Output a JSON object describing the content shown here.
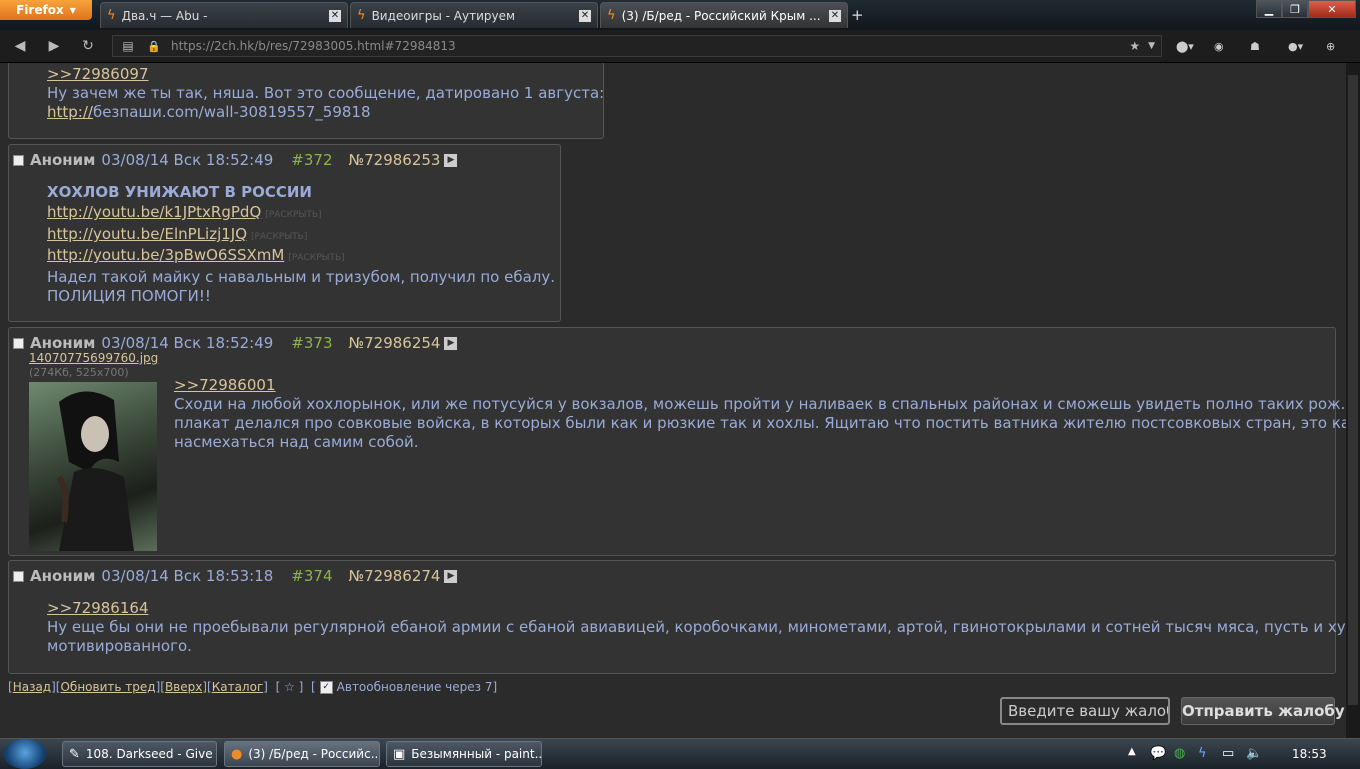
{
  "browser": {
    "menu_button": "Firefox",
    "tabs": [
      {
        "title": "Два.ч — Abu -"
      },
      {
        "title": "Видеоигры - Аутируем"
      },
      {
        "title": "(3) /Б/ред - Российский Крым ..."
      }
    ],
    "url": "https://2ch.hk/b/res/72983005.html#72984813"
  },
  "posts": {
    "p0": {
      "reply_link": ">>72986097",
      "text": "Ну зачем же ты так, няша. Вот это сообщение, датировано 1 августа:",
      "link_http": "http://",
      "link_rest": "безпаши.com/wall-30819557_59818"
    },
    "p372": {
      "name": "Аноним",
      "date": "03/08/14 Вск 18:52:49",
      "num": "#372",
      "pno": "№72986253",
      "headline": "ХОХЛОВ УНИЖАЮТ В РОССИИ",
      "links": [
        {
          "url": "http://youtu.be/k1JPtxRgPdQ",
          "expand": "[РАСКРЫТЬ]"
        },
        {
          "url": "http://youtu.be/ElnPLizj1JQ",
          "expand": "[РАСКРЫТЬ]"
        },
        {
          "url": "http://youtu.be/3pBwO6SSXmM",
          "expand": "[РАСКРЫТЬ]"
        }
      ],
      "line1": "Надел такой майку с навальным и тризубом, получил по ебалу.",
      "line2": "ПОЛИЦИЯ ПОМОГИ!!"
    },
    "p373": {
      "name": "Аноним",
      "date": "03/08/14 Вск 18:52:49",
      "num": "#373",
      "pno": "№72986254",
      "file_name": "14070775699760.jpg",
      "file_info": "(274Кб, 525x700)",
      "reply_link": ">>72986001",
      "line1": "Сходи на любой хохлорынок, или же потусуйся у вокзалов, можешь пройти у наливаек в спальных районах и сможешь увидеть полно таких рож. А",
      "line2": "плакат делался про совковые войска, в которых были как и рюзкие так и хохлы. Ящитаю что постить ватника жителю постсовковых стран, это как",
      "line3": "насмехаться над самим собой."
    },
    "p374": {
      "name": "Аноним",
      "date": "03/08/14 Вск 18:53:18",
      "num": "#374",
      "pno": "№72986274",
      "reply_link": ">>72986164",
      "line1": "Ну еще бы они не проебывали регулярной ебаной армии с ебаной авиавицей, коробочками, минометами, артой, гвинотокрылами и сотней тысяч мяса, пусть и хуево",
      "line2": "мотивированного."
    }
  },
  "bottom_nav": {
    "back": "Назад",
    "refresh": "Обновить тред",
    "up": "Вверх",
    "catalog": "Каталог",
    "star": "☆",
    "autoupdate": "Автообновление через 7]"
  },
  "complaint": {
    "placeholder": "Введите вашу жалобу",
    "submit": "Отправить жалобу"
  },
  "taskbar": {
    "tasks": [
      {
        "label": "108. Darkseed - Give ..."
      },
      {
        "label": "(3) /Б/ред - Российс..."
      },
      {
        "label": "Безымянный - paint..."
      }
    ],
    "clock": "18:53"
  }
}
